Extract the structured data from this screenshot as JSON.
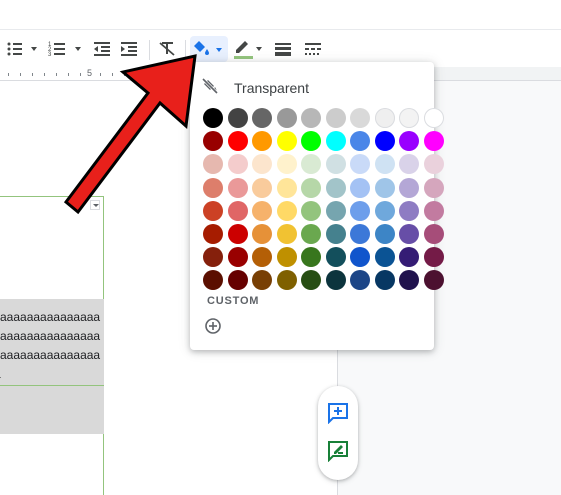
{
  "toolbar": {
    "buttons": [
      {
        "name": "bulleted-list-icon"
      },
      {
        "name": "numbered-list-icon"
      },
      {
        "name": "decrease-indent-icon"
      },
      {
        "name": "increase-indent-icon"
      },
      {
        "name": "clear-formatting-icon"
      },
      {
        "name": "fill-color-icon"
      },
      {
        "name": "border-color-icon"
      },
      {
        "name": "border-width-icon"
      },
      {
        "name": "border-dash-icon"
      }
    ]
  },
  "ruler": {
    "number": "5"
  },
  "document": {
    "lines": [
      "aaaaaaaaaaaaaaa",
      "aaaaaaaaaaaaaaa",
      "aaaaaaaaaaaaaaa",
      "a"
    ]
  },
  "color_popup": {
    "transparent_label": "Transparent",
    "custom_label": "CUSTOM",
    "rows": [
      [
        "#000000",
        "#434343",
        "#666666",
        "#999999",
        "#b7b7b7",
        "#cccccc",
        "#d9d9d9",
        "#efefef",
        "#f3f3f3",
        "#ffffff"
      ],
      [
        "#980000",
        "#ff0000",
        "#ff9900",
        "#ffff00",
        "#00ff00",
        "#00ffff",
        "#4a86e8",
        "#0000ff",
        "#9900ff",
        "#ff00ff"
      ],
      [
        "#e6b8af",
        "#f4cccc",
        "#fce5cd",
        "#fff2cc",
        "#d9ead3",
        "#d0e0e3",
        "#c9daf8",
        "#cfe2f3",
        "#d9d2e9",
        "#ead1dc"
      ],
      [
        "#dd7e6b",
        "#ea9999",
        "#f9cb9c",
        "#ffe599",
        "#b6d7a8",
        "#a2c4c9",
        "#a4c2f4",
        "#9fc5e8",
        "#b4a7d6",
        "#d5a6bd"
      ],
      [
        "#cc4125",
        "#e06666",
        "#f6b26b",
        "#ffd966",
        "#93c47d",
        "#76a5af",
        "#6d9eeb",
        "#6fa8dc",
        "#8e7cc3",
        "#c27ba0"
      ],
      [
        "#a61c00",
        "#cc0000",
        "#e69138",
        "#f1c232",
        "#6aa84f",
        "#45818e",
        "#3c78d8",
        "#3d85c6",
        "#674ea7",
        "#a64d79"
      ],
      [
        "#85200c",
        "#990000",
        "#b45f06",
        "#bf9000",
        "#38761d",
        "#134f5c",
        "#1155cc",
        "#0b5394",
        "#351c75",
        "#741b47"
      ],
      [
        "#5b0f00",
        "#660000",
        "#783f04",
        "#7f6000",
        "#274e13",
        "#0c343d",
        "#1c4587",
        "#073763",
        "#20124d",
        "#4c1130"
      ]
    ]
  },
  "side_actions": [
    {
      "name": "add-comment-icon",
      "color": "#1a73e8"
    },
    {
      "name": "suggest-edits-icon",
      "color": "#188038"
    }
  ],
  "colors": {
    "accent": "#1a73e8",
    "arrow_red": "#e8201b",
    "table_border": "#93c47d",
    "cell_shading": "#d9d9d9"
  }
}
